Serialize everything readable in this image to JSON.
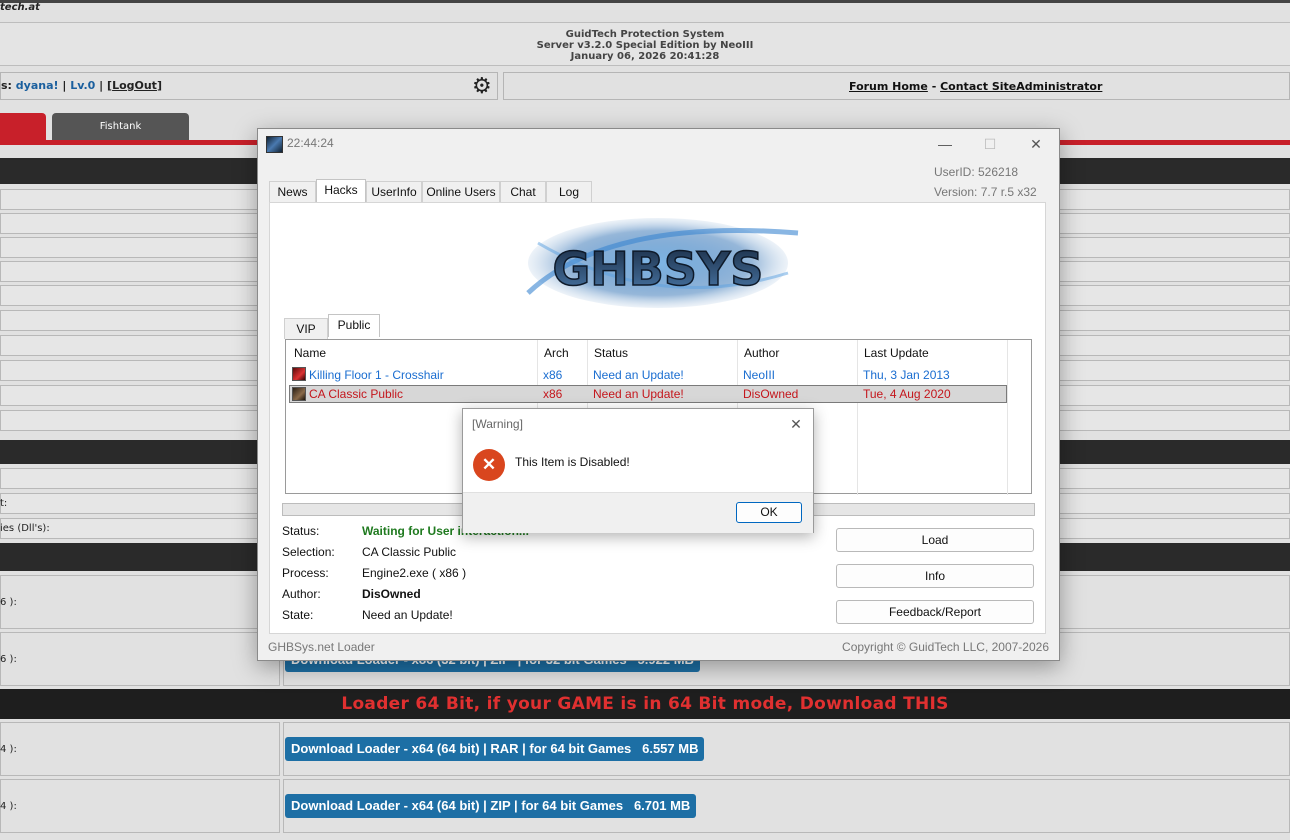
{
  "page": {
    "site_logo": "tech.at",
    "header": {
      "line1": "GuidTech Protection System",
      "line2": "Server v3.2.0 Special Edition by NeoIII",
      "line3": "January 06, 2026 20:41:28"
    },
    "user_bar": {
      "prefix": "s: ",
      "username": "dyana!",
      "sep1": " | ",
      "level": "Lv.0",
      "sep2": " | [",
      "logout": "LogOut",
      "close": "]"
    },
    "nav": {
      "forum_home": "Forum Home",
      "dash": " - ",
      "contact": "Contact SiteAdministrator"
    },
    "tabs": {
      "fishtank": "Fishtank"
    },
    "row_labels": {
      "r1": "t:",
      "r2": "ies (Dll's):",
      "r3": "6 ):",
      "r4": "6 ):",
      "r5": "4 ):",
      "r6": "4 ):"
    },
    "banner_64": "Loader 64 Bit, if your GAME is in 64 Bit mode, Download THIS",
    "downloads": {
      "x86_zip": "Download Loader - x86 (32 bit) | ZIP  | for 32 bit Games   5.922 MB",
      "x64_rar": "Download Loader - x64 (64 bit) | RAR | for 64 bit Games   6.557 MB",
      "x64_zip": "Download Loader - x64 (64 bit) | ZIP | for 64 bit Games   6.701 MB"
    }
  },
  "window": {
    "title": "22:44:24",
    "controls": {
      "minimize": "—",
      "maximize": "☐",
      "close": "✕"
    },
    "user_id": "UserID: 526218",
    "version": "Version: 7.7 r.5 x32",
    "tabs": [
      "News",
      "Hacks",
      "UserInfo",
      "Online Users",
      "Chat",
      "Log"
    ],
    "active_tab": "Hacks",
    "logo_text": "GHBSYS",
    "sub_tabs": [
      "VIP",
      "Public"
    ],
    "active_sub_tab": "Public",
    "columns": [
      "Name",
      "Arch",
      "Status",
      "Author",
      "Last Update"
    ],
    "rows": [
      {
        "name": "Killing Floor 1 - Crosshair",
        "arch": "x86",
        "status": "Need an Update!",
        "author": "NeoIII",
        "last_update": "Thu, 3 Jan 2013",
        "color": "#1a6dd0",
        "selected": false
      },
      {
        "name": "CA Classic Public",
        "arch": "x86",
        "status": "Need an Update!",
        "author": "DisOwned",
        "last_update": "Tue, 4 Aug 2020",
        "color": "#c4161c",
        "selected": true
      }
    ],
    "details": {
      "status_label": "Status:",
      "status_value": "Waiting for User interaction...",
      "selection_label": "Selection:",
      "selection_value": "CA Classic Public",
      "process_label": "Process:",
      "process_value": "Engine2.exe ( x86 )",
      "author_label": "Author:",
      "author_value": "DisOwned",
      "state_label": "State:",
      "state_value": "Need an Update!"
    },
    "buttons": {
      "load": "Load",
      "info": "Info",
      "feedback": "Feedback/Report"
    },
    "footer_left": "GHBSys.net Loader",
    "footer_right": "Copyright © GuidTech LLC, 2007-2026",
    "status_color": "#1f7a1f"
  },
  "dialog": {
    "title": "[Warning]",
    "message": "This Item is Disabled!",
    "ok": "OK",
    "icon": "error-icon",
    "icon_color": "#d9461e"
  }
}
